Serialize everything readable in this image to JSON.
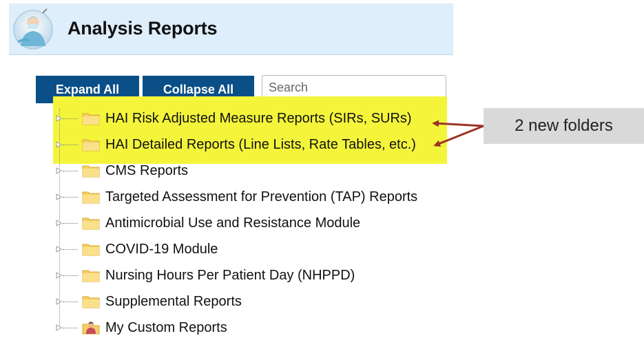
{
  "header": {
    "title": "Analysis Reports",
    "logo_icon": "clinician-logo-icon"
  },
  "toolbar": {
    "expand_label": "Expand All",
    "collapse_label": "Collapse All",
    "search_placeholder": "Search",
    "button_color": "#0a4f87"
  },
  "tree": {
    "items": [
      {
        "label": "HAI Risk Adjusted Measure Reports (SIRs, SURs)",
        "icon": "folder-icon"
      },
      {
        "label": "HAI Detailed Reports (Line Lists, Rate Tables, etc.)",
        "icon": "folder-icon"
      },
      {
        "label": "CMS Reports",
        "icon": "folder-icon"
      },
      {
        "label": "Targeted Assessment for Prevention (TAP) Reports",
        "icon": "folder-icon"
      },
      {
        "label": "Antimicrobial Use and Resistance Module",
        "icon": "folder-icon"
      },
      {
        "label": "COVID-19 Module",
        "icon": "folder-icon"
      },
      {
        "label": "Nursing Hours Per Patient Day (NHPPD)",
        "icon": "folder-icon"
      },
      {
        "label": "Supplemental Reports",
        "icon": "folder-icon"
      },
      {
        "label": "My Custom Reports",
        "icon": "user-folder-icon"
      }
    ]
  },
  "annotation": {
    "callout_text": "2 new folders",
    "highlight_color": "#f4f53b",
    "arrow_color": "#9b3426"
  }
}
